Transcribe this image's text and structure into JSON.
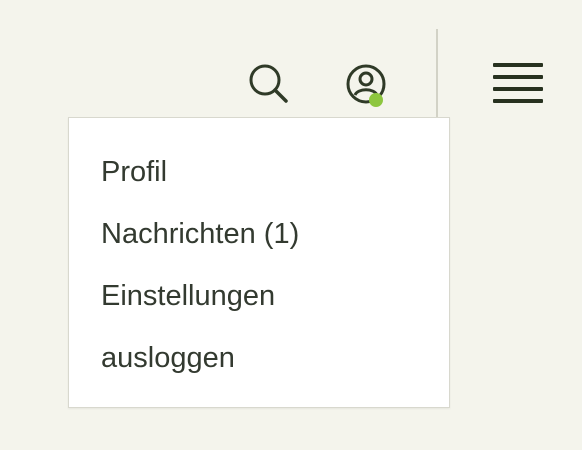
{
  "header": {
    "search_icon": "search-icon",
    "account_icon": "user-circle-icon",
    "menu_icon": "hamburger-menu-icon",
    "status_color": "#8dc63f"
  },
  "dropdown": {
    "items": [
      {
        "label": "Profil"
      },
      {
        "label": "Nachrichten (1)"
      },
      {
        "label": "Einstellungen"
      },
      {
        "label": "ausloggen"
      }
    ]
  }
}
